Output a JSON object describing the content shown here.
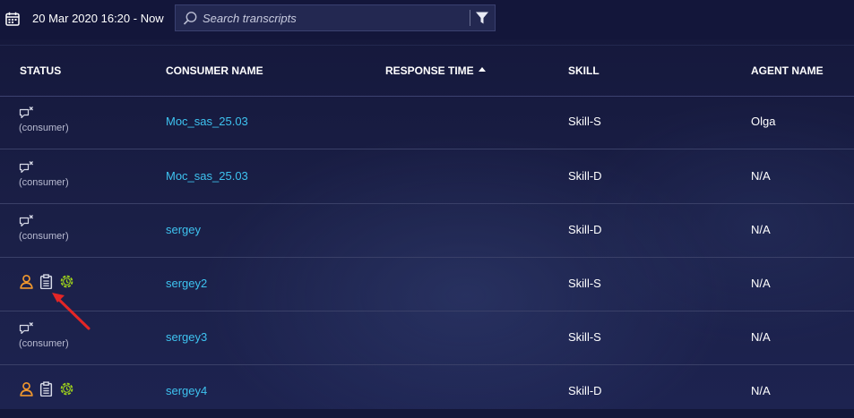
{
  "toolbar": {
    "date_range": "20 Mar 2020 16:20 - Now",
    "search_placeholder": "Search transcripts"
  },
  "columns": {
    "status": "STATUS",
    "consumer_name": "CONSUMER NAME",
    "response_time": "RESPONSE TIME",
    "skill": "SKILL",
    "agent_name": "AGENT NAME"
  },
  "rows": [
    {
      "status": "ended",
      "status_label": "(consumer)",
      "consumer_name": "Moc_sas_25.03",
      "skill": "Skill-S",
      "agent_name": "Olga"
    },
    {
      "status": "ended",
      "status_label": "(consumer)",
      "consumer_name": "Moc_sas_25.03",
      "skill": "Skill-D",
      "agent_name": "N/A"
    },
    {
      "status": "ended",
      "status_label": "(consumer)",
      "consumer_name": "sergey",
      "skill": "Skill-D",
      "agent_name": "N/A"
    },
    {
      "status": "active",
      "status_icons": [
        "person-icon",
        "clipboard-icon",
        "clock-gear-icon"
      ],
      "consumer_name": "sergey2",
      "skill": "Skill-S",
      "agent_name": "N/A"
    },
    {
      "status": "ended",
      "status_label": "(consumer)",
      "consumer_name": "sergey3",
      "skill": "Skill-S",
      "agent_name": "N/A"
    },
    {
      "status": "active",
      "status_icons": [
        "person-icon",
        "clipboard-icon",
        "clock-gear-icon"
      ],
      "consumer_name": "sergey4",
      "skill": "Skill-D",
      "agent_name": "N/A"
    }
  ],
  "colors": {
    "link": "#3ec3f0",
    "person_icon": "#f0972e",
    "clock_icon": "#9ccf1c",
    "annotation_arrow": "#e32626"
  }
}
